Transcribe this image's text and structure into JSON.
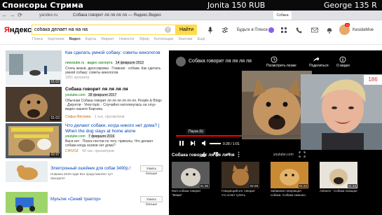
{
  "stream": {
    "title": "Спонсоры Стрима",
    "donation_1": "Jonita 150 RUB",
    "donation_2": "George 135 R"
  },
  "browser": {
    "url": "yandex.ru",
    "tab_title": "Собака говорит ля ля ля ля — Яндекс.Видео",
    "tab2": "Собака"
  },
  "header": {
    "logo_ya": "Я",
    "logo_rest": "ндекс",
    "search_value": "собака делает на на на",
    "search_clear": "×",
    "find_label": "Найти",
    "plus_promo": "Будьте в Плюсе",
    "avatar_badge": "99",
    "username": "KesidaMoe"
  },
  "services": [
    {
      "label": "Поиск",
      "active": false
    },
    {
      "label": "Картинки",
      "active": false
    },
    {
      "label": "Видео",
      "active": true
    },
    {
      "label": "Карты",
      "active": false
    },
    {
      "label": "Маркет",
      "active": false
    },
    {
      "label": "Новости",
      "active": false
    },
    {
      "label": "Эфир",
      "active": false
    },
    {
      "label": "Коллекции",
      "active": false
    },
    {
      "label": "Знатоки",
      "active": false
    },
    {
      "label": "Ещё",
      "active": false
    }
  ],
  "results": [
    {
      "title": "Как сделать умной собаку: советы кинологов",
      "source": "newstube.ru",
      "source_extra": "· видео эксперта",
      "date": "14 февраля 2012",
      "desc": "Стиль жизни. дрессировка · Главная · собаки. Как сделать умной собаку: советы кинологов.",
      "views": "1051 просмотр",
      "duration": "01:02"
    },
    {
      "title": "Собака говорит ля ля ля ля",
      "source": "youtube.com",
      "source_extra": "",
      "date": "28 февраля 2017",
      "desc": "Обычная Собака говорит ля ля ля ля ля ля. People & Blogs · Джунгли · View topic · Случайно натолкнулась на хлуу-видео нашего Барсика.",
      "author": "Софья Вятхина",
      "views": "1 тыс. просмотров",
      "duration": "01:03"
    },
    {
      "title": "Что делают собаки, когда никого нет дома? | When the dog stays at home alone",
      "source": "youtube.com",
      "source_extra": "",
      "date": "7 февраля 2016",
      "desc": "Вася.нет · Поиск постов по тегу: приколы. Что делают собаки когда хозяев нет дома?",
      "author": "CHIVOZ",
      "views": "69 тыс. просмотров",
      "duration": "02:37"
    }
  ],
  "ads": [
    {
      "title": "Электронный ошейник для собак 3490р.!",
      "sub": "Новинка 2019 года! Все представлено тут! Заходите!",
      "button": "Узнать больше"
    },
    {
      "title": "Мультик «Синий трактор»",
      "sub": "",
      "button": "Узнать больше"
    }
  ],
  "player": {
    "title": "Собака говорит ля ля ля ля",
    "later": "Посмотреть позже",
    "share": "Поделиться",
    "info": "О видео",
    "pause_tip": "Пауза (k)",
    "progress": 0.47,
    "time": "0:28 / 1:01",
    "below_title": "Собака говорит ля ля ля ля",
    "yt_label": "youtube.com"
  },
  "related": [
    {
      "caption": "Моя собака говорит \"Мама\"",
      "duration": "01:36"
    },
    {
      "caption": "Говорящий кот говорит что хочет гулять",
      "duration": "02:29"
    },
    {
      "caption": "Забавная говорящая собака. Собака смешно",
      "duration": "01:22"
    },
    {
      "caption": "Aslanes - Собака поющая",
      "duration": "01:34"
    }
  ],
  "cam": {
    "viewer_count": "186"
  }
}
